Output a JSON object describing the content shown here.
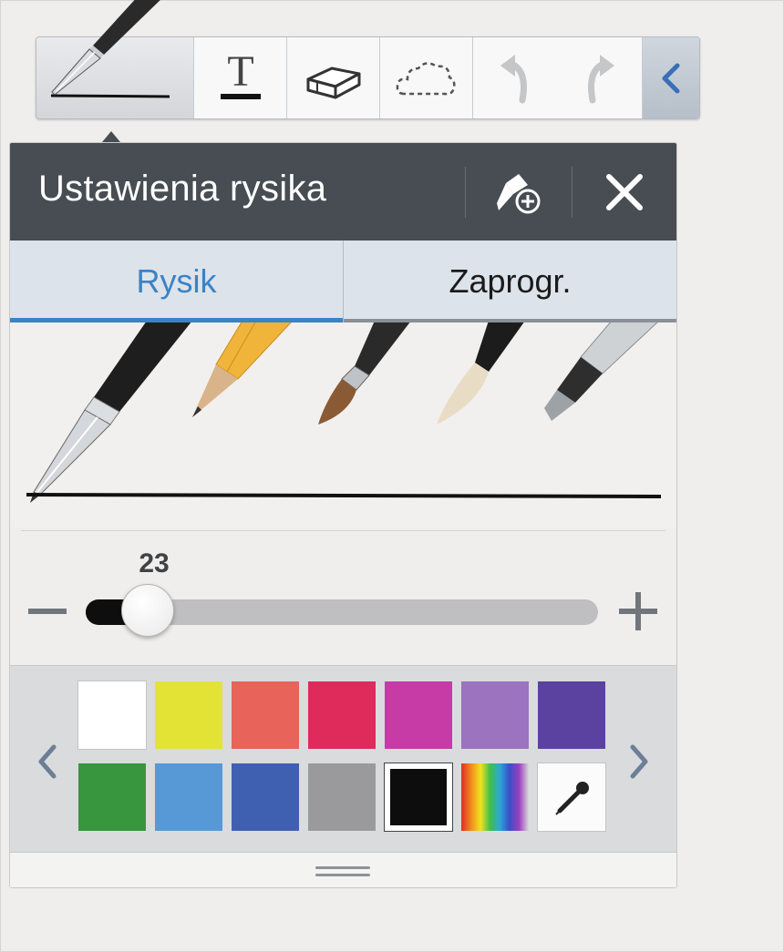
{
  "toolbar": {
    "tools": [
      {
        "name": "pen",
        "icon": "pen-icon",
        "active": true
      },
      {
        "name": "text",
        "icon": "text-icon",
        "glyph": "T"
      },
      {
        "name": "eraser",
        "icon": "eraser-icon"
      },
      {
        "name": "selection",
        "icon": "lasso-icon"
      },
      {
        "name": "undo",
        "icon": "undo-icon"
      },
      {
        "name": "redo",
        "icon": "redo-icon"
      },
      {
        "name": "collapse",
        "icon": "chevron-left-icon"
      }
    ]
  },
  "pen_settings": {
    "title": "Ustawienia rysika",
    "add_preset_icon": "pen-add-icon",
    "close_icon": "close-icon",
    "tabs": [
      {
        "label": "Rysik",
        "selected": true
      },
      {
        "label": "Zaprogr.",
        "selected": false
      }
    ],
    "pen_types": [
      {
        "name": "fountain-pen",
        "selected": true
      },
      {
        "name": "pencil",
        "selected": false
      },
      {
        "name": "brush",
        "selected": false
      },
      {
        "name": "calligraphy-brush",
        "selected": false
      },
      {
        "name": "marker",
        "selected": false
      }
    ],
    "size": {
      "value": "23",
      "fraction": 0.12
    },
    "colors": [
      {
        "hex": "#ffffff",
        "selected": false
      },
      {
        "hex": "#e3e336",
        "selected": false
      },
      {
        "hex": "#e8645a",
        "selected": false
      },
      {
        "hex": "#df2b5b",
        "selected": false
      },
      {
        "hex": "#c63ba6",
        "selected": false
      },
      {
        "hex": "#9b73be",
        "selected": false
      },
      {
        "hex": "#5b41a0",
        "selected": false
      },
      {
        "hex": "#38963f",
        "selected": false
      },
      {
        "hex": "#5799d7",
        "selected": false
      },
      {
        "hex": "#3f5fb0",
        "selected": false
      },
      {
        "hex": "#9a9a9c",
        "selected": false
      },
      {
        "hex": "#0d0d0d",
        "selected": true
      },
      {
        "hex": "rainbow",
        "selected": false
      },
      {
        "hex": "eyedropper",
        "selected": false
      }
    ]
  },
  "colors_ui": {
    "accent": "#3a83c5",
    "header_bg": "#474d53"
  }
}
